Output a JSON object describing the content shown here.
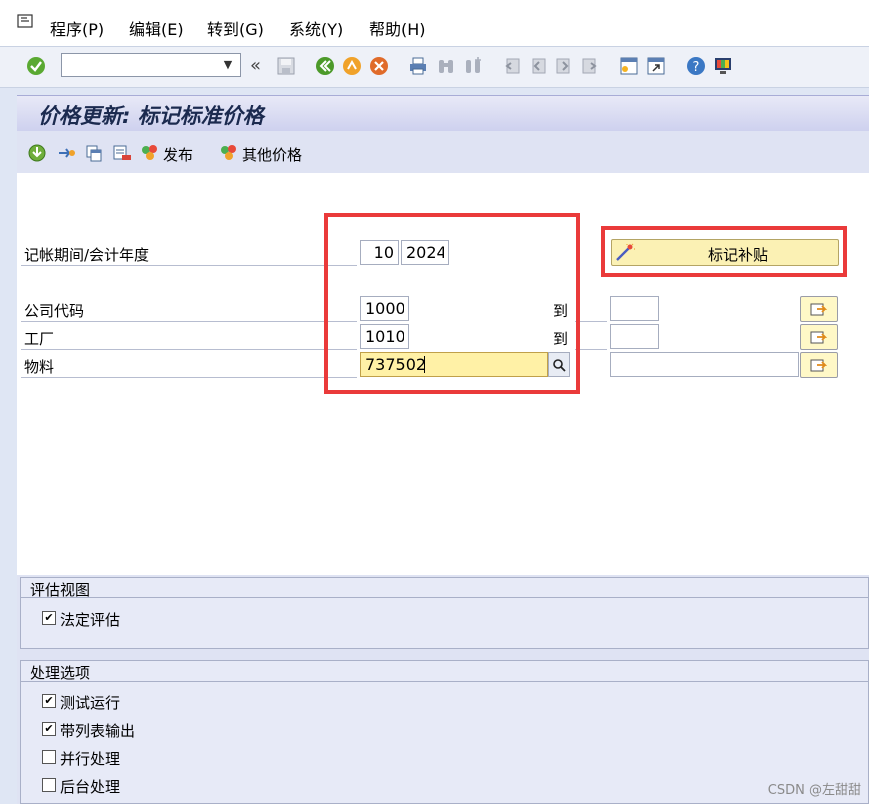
{
  "menu": {
    "items": [
      {
        "label": "程序(P)"
      },
      {
        "label": "编辑(E)"
      },
      {
        "label": "转到(G)"
      },
      {
        "label": "系统(Y)"
      },
      {
        "label": "帮助(H)"
      }
    ]
  },
  "toolbar": {
    "command_value": "",
    "back_glyph": "«"
  },
  "screen": {
    "title": "价格更新: 标记标准价格"
  },
  "app_toolbar": {
    "release_label": "发布",
    "other_prices_label": "其他价格"
  },
  "form": {
    "period_label": "记帐期间/会计年度",
    "period_value": "10",
    "year_value": "2024",
    "mark_allowance_button": "标记补贴",
    "company_label": "公司代码",
    "company_from": "1000",
    "company_to_label": "到",
    "company_to": "",
    "plant_label": "工厂",
    "plant_from": "1010",
    "plant_to_label": "到",
    "plant_to": "",
    "material_label": "物料",
    "material_from": "737502",
    "material_to": ""
  },
  "valuation_view": {
    "header": "评估视图",
    "legal_valuation_label": "法定评估",
    "legal_valuation_checked": true
  },
  "processing_options": {
    "header": "处理选项",
    "items": [
      {
        "label": "测试运行",
        "checked": true
      },
      {
        "label": "带列表输出",
        "checked": true
      },
      {
        "label": "并行处理",
        "checked": false
      },
      {
        "label": "后台处理",
        "checked": false
      }
    ]
  },
  "watermark": "CSDN @左甜甜",
  "colors": {
    "highlight_box": "#ea3a3a",
    "focus_field": "#fff1a6",
    "button_bg": "#fbf1b4"
  }
}
